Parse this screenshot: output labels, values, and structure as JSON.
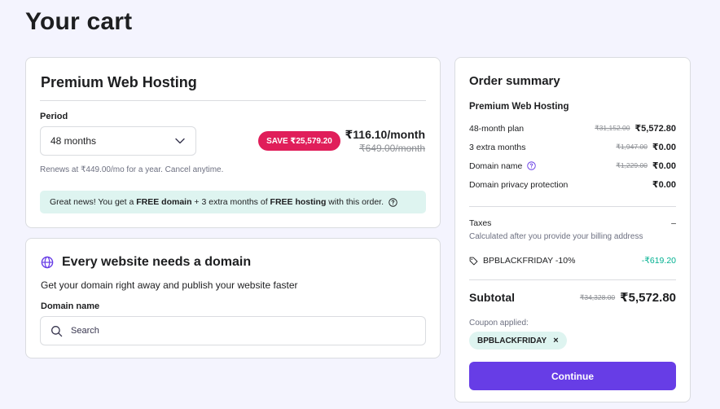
{
  "page": {
    "title": "Your cart"
  },
  "hosting": {
    "title": "Premium Web Hosting",
    "period_label": "Period",
    "period_value": "48 months",
    "save_badge": "SAVE ₹25,579.20",
    "price": "₹116.10/month",
    "old_price": "₹649.00/month",
    "renews": "Renews at ₹449.00/mo for a year. Cancel anytime.",
    "banner": {
      "t1": "Great news! You get a ",
      "b1": "FREE domain",
      "t2": " + 3 extra months of ",
      "b2": "FREE hosting",
      "t3": " with this order."
    }
  },
  "domain": {
    "title": "Every website needs a domain",
    "subtitle": "Get your domain right away and publish your website faster",
    "label": "Domain name",
    "search_placeholder": "Search"
  },
  "summary": {
    "title": "Order summary",
    "product": "Premium Web Hosting",
    "lines": [
      {
        "label": "48-month plan",
        "old": "₹31,152.00",
        "value": "₹5,572.80"
      },
      {
        "label": "3 extra months",
        "old": "₹1,947.00",
        "value": "₹0.00"
      },
      {
        "label": "Domain name",
        "old": "₹1,229.00",
        "value": "₹0.00"
      },
      {
        "label": "Domain privacy protection",
        "old": "",
        "value": "₹0.00"
      }
    ],
    "taxes_label": "Taxes",
    "taxes_value": "–",
    "taxes_note": "Calculated after you provide your billing address",
    "coupon_line": "BPBLACKFRIDAY -10%",
    "coupon_discount": "-₹619.20",
    "subtotal_label": "Subtotal",
    "subtotal_old": "₹34,328.00",
    "subtotal_value": "₹5,572.80",
    "coupon_applied_label": "Coupon applied:",
    "coupon_code": "BPBLACKFRIDAY",
    "coupon_remove": "×",
    "continue_label": "Continue"
  }
}
